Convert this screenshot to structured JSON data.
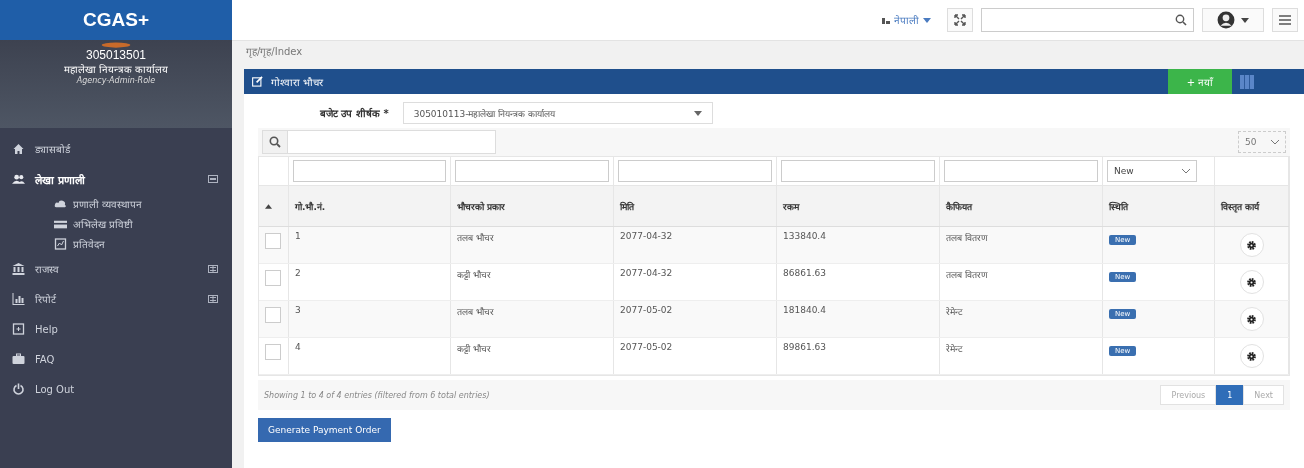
{
  "sidebar": {
    "brand": "CGAS+",
    "profile": {
      "code": "305013501",
      "office": "महालेखा नियन्त्रक कार्यालय",
      "role": "Agency-Admin-Role"
    },
    "items": [
      {
        "label": "ड्यासबोर्ड",
        "kind": "link"
      },
      {
        "label": "लेखा प्रणाली",
        "kind": "group",
        "expanded": true,
        "children": [
          {
            "label": "प्रणाली व्यवस्थापन"
          },
          {
            "label": "अभिलेख प्रविष्टी"
          },
          {
            "label": "प्रतिवेदन"
          }
        ]
      },
      {
        "label": "राजस्व",
        "kind": "group",
        "expanded": false
      },
      {
        "label": "रिपोर्ट",
        "kind": "group",
        "expanded": false
      },
      {
        "label": "Help",
        "kind": "link"
      },
      {
        "label": "FAQ",
        "kind": "link"
      },
      {
        "label": "Log Out",
        "kind": "link"
      }
    ]
  },
  "topbar": {
    "language": "नेपाली"
  },
  "breadcrumb": "गृह/गृह/Index",
  "panel": {
    "title": "गोश्वारा भौचर",
    "add_button": "+ नयाँ",
    "budget_label": "बजेट उप शीर्षक *",
    "budget_value": "305010113-महालेखा नियन्त्रक कार्यालय",
    "page_size": "50",
    "status_filter": "New",
    "table": {
      "columns": [
        "गो.भौ.नं.",
        "भौचरको प्रकार",
        "मिति",
        "रकम",
        "कैफियत",
        "स्थिति",
        "विस्तृत कार्य"
      ],
      "rows": [
        {
          "checked": false,
          "cells": [
            "1",
            "तलब भौचर",
            "2077-04-32",
            "133840.4",
            "तलब वितरण"
          ],
          "status": "New"
        },
        {
          "checked": false,
          "cells": [
            "2",
            "कट्टी भौचर",
            "2077-04-32",
            "86861.63",
            "तलब वितरण"
          ],
          "status": "New"
        },
        {
          "checked": false,
          "cells": [
            "3",
            "तलब भौचर",
            "2077-05-02",
            "181840.4",
            "रेमेन्ट"
          ],
          "status": "New"
        },
        {
          "checked": false,
          "cells": [
            "4",
            "कट्टी भौचर",
            "2077-05-02",
            "89861.63",
            "रेमेन्ट"
          ],
          "status": "New"
        }
      ]
    },
    "info": "Showing 1 to 4 of 4 entries (filtered from 6 total entries)",
    "pagination": [
      {
        "label": "Previous",
        "selected": false
      },
      {
        "label": "1",
        "selected": true
      },
      {
        "label": "Next",
        "selected": false
      }
    ]
  },
  "primary_button": "Generate Payment Order"
}
